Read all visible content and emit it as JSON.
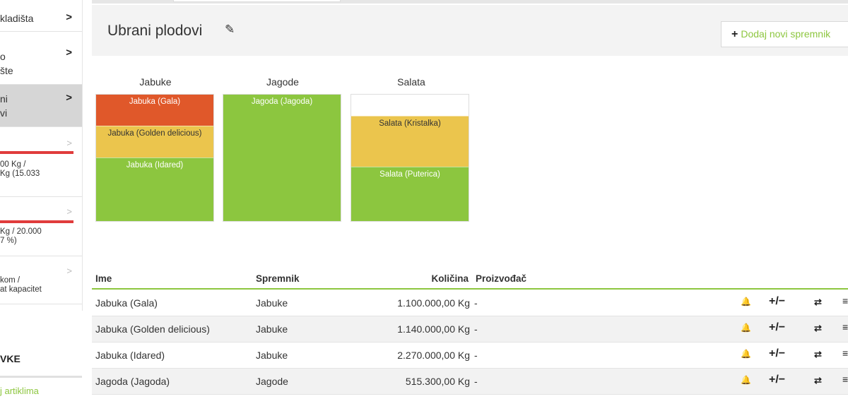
{
  "sidebar": {
    "items": [
      {
        "lines": [
          "kladišta"
        ],
        "chevron": ">"
      },
      {
        "lines": [
          "o",
          "šte"
        ],
        "chevron": ">"
      },
      {
        "lines": [
          "ni",
          "vi"
        ],
        "chevron": ">"
      },
      {
        "lines": [
          "00 Kg /",
          "Kg (15.033"
        ],
        "chevron": ">"
      },
      {
        "lines": [
          "Kg / 20.000",
          "7 %)"
        ],
        "chevron": ">"
      },
      {
        "lines": [
          "kom /",
          "at kapacitet"
        ],
        "chevron": ">"
      }
    ],
    "heading": "VKE",
    "link": "j artiklima"
  },
  "header": {
    "title": "Ubrani plodovi",
    "edit_icon": "pencil-icon",
    "add_button": "Dodaj novi spremnik",
    "add_icon": "plus-icon"
  },
  "containers": [
    {
      "name": "Jabuke",
      "segments": [
        {
          "label": "Jabuka (Gala)",
          "fraction": 0.244,
          "color": "#e0582a",
          "text_color": "#ffffff"
        },
        {
          "label": "Jabuka (Golden delicious)",
          "fraction": 0.253,
          "color": "#ebc54d",
          "text_color": "#333333"
        },
        {
          "label": "Jabuka (Idared)",
          "fraction": 0.503,
          "color": "#8cc63f",
          "text_color": "#ffffff"
        }
      ]
    },
    {
      "name": "Jagode",
      "segments": [
        {
          "label": "Jagoda (Jagoda)",
          "fraction": 1.0,
          "color": "#8cc63f",
          "text_color": "#ffffff"
        }
      ]
    },
    {
      "name": "Salata",
      "segments": [
        {
          "label": "",
          "fraction": 0.167,
          "color": "#ffffff",
          "text_color": "#333333"
        },
        {
          "label": "Salata (Kristalka)",
          "fraction": 0.4,
          "color": "#ebc54d",
          "text_color": "#333333"
        },
        {
          "label": "Salata (Puterica)",
          "fraction": 0.433,
          "color": "#8cc63f",
          "text_color": "#ffffff"
        }
      ]
    }
  ],
  "table": {
    "headers": {
      "name": "Ime",
      "container": "Spremnik",
      "quantity": "Količina",
      "producer": "Proizvođač"
    },
    "rows": [
      {
        "name": "Jabuka (Gala)",
        "container": "Jabuke",
        "quantity": "1.100.000,00 Kg",
        "producer": "-"
      },
      {
        "name": "Jabuka (Golden delicious)",
        "container": "Jabuke",
        "quantity": "1.140.000,00 Kg",
        "producer": "-"
      },
      {
        "name": "Jabuka (Idared)",
        "container": "Jabuke",
        "quantity": "2.270.000,00 Kg",
        "producer": "-"
      },
      {
        "name": "Jagoda (Jagoda)",
        "container": "Jagode",
        "quantity": "515.300,00 Kg",
        "producer": "-"
      }
    ],
    "row_actions": {
      "adjust": "+/−",
      "transfer": "⇄",
      "menu": "≡"
    }
  },
  "colors": {
    "accent": "#8dc63f",
    "warning": "#e03c3c"
  }
}
